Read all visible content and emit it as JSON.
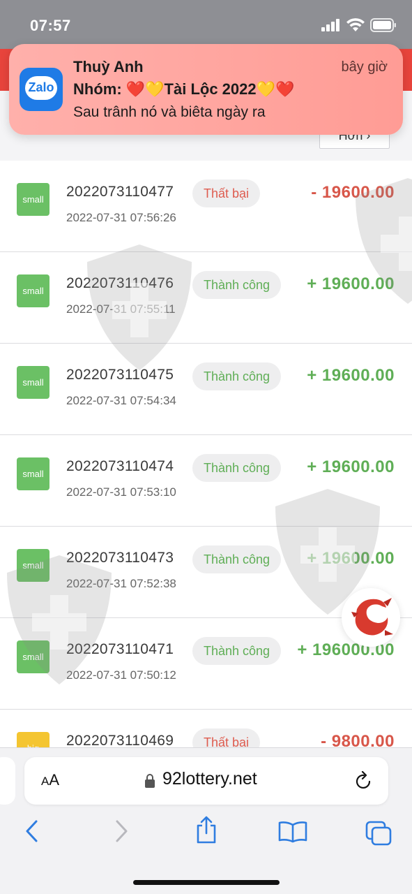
{
  "status_bar": {
    "time": "07:57"
  },
  "notification": {
    "app_icon_label": "Zalo",
    "sender": "Thuỳ Anh",
    "time": "bây giờ",
    "group": "Nhóm: ❤️💛Tài Lộc 2022💛❤️",
    "body": "Sau trânh nó và biêta ngày ra"
  },
  "header": {
    "more_label": "Hơn ›"
  },
  "transactions": [
    {
      "type": "small",
      "order_id": "2022073110477",
      "time": "2022-07-31 07:56:26",
      "status": "Thất bại",
      "status_kind": "fail",
      "amount": "- 19600.00",
      "sign": "negative"
    },
    {
      "type": "small",
      "order_id": "2022073110476",
      "time": "2022-07-31 07:55:11",
      "status": "Thành công",
      "status_kind": "success",
      "amount": "+ 19600.00",
      "sign": "positive"
    },
    {
      "type": "small",
      "order_id": "2022073110475",
      "time": "2022-07-31 07:54:34",
      "status": "Thành công",
      "status_kind": "success",
      "amount": "+ 19600.00",
      "sign": "positive"
    },
    {
      "type": "small",
      "order_id": "2022073110474",
      "time": "2022-07-31 07:53:10",
      "status": "Thành công",
      "status_kind": "success",
      "amount": "+ 19600.00",
      "sign": "positive"
    },
    {
      "type": "small",
      "order_id": "2022073110473",
      "time": "2022-07-31 07:52:38",
      "status": "Thành công",
      "status_kind": "success",
      "amount": "+ 19600.00",
      "sign": "positive"
    },
    {
      "type": "small",
      "order_id": "2022073110471",
      "time": "2022-07-31 07:50:12",
      "status": "Thành công",
      "status_kind": "success",
      "amount": "+ 196000.00",
      "sign": "positive"
    },
    {
      "type": "big",
      "order_id": "2022073110469",
      "time": "",
      "status": "Thất bại",
      "status_kind": "fail",
      "amount": "- 9800.00",
      "sign": "negative"
    }
  ],
  "browser": {
    "aa_label_small": "A",
    "aa_label_big": "A",
    "url": "92lottery.net"
  },
  "colors": {
    "header_red": "#e8443c",
    "success_green": "#5fae56",
    "fail_red": "#d8574a",
    "small_badge": "#6bc065",
    "big_badge": "#f4c531",
    "ios_blue": "#2f7de0"
  }
}
